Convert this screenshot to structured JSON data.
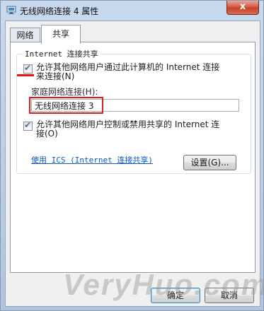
{
  "window": {
    "title": "无线网络连接 4 属性",
    "close_label": "x"
  },
  "tabs": [
    {
      "label": "网络",
      "selected": false
    },
    {
      "label": "共享",
      "selected": true
    }
  ],
  "group": {
    "title": "Internet 连接共享",
    "checkbox1": {
      "checked": true,
      "line1": "允许其他网络用户通过此计算机的 Internet 连接",
      "line2": "来连接(N)"
    },
    "home_connection": {
      "label": "家庭网络连接(H):",
      "value": "无线网络连接 3"
    },
    "checkbox2": {
      "checked": true,
      "line1": "允许其他网络用户控制或禁用共享的 Internet 连",
      "line2": "接(O)"
    }
  },
  "link": "使用 ICS (Internet 连接共享)",
  "settings_button": "设置(G)...",
  "ok_button": "确定",
  "cancel_button": "取消",
  "watermark": "VeryHuo.com",
  "colors": {
    "annotation_red": "#d81e1e",
    "link_blue": "#0a58c5",
    "close_red": "#c7402a"
  }
}
